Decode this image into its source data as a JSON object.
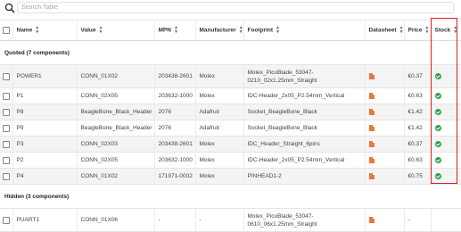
{
  "search": {
    "placeholder": "Search Table"
  },
  "columns": [
    "Name",
    "Value",
    "MPN",
    "Manufacturer",
    "Footprint",
    "Datasheet",
    "Price",
    "Stock"
  ],
  "groups": [
    {
      "label": "Quoted (7 components)",
      "rows": [
        {
          "name": "POWER1",
          "value": "CONN_01X02",
          "mpn": "203438-2601",
          "manufacturer": "Molex",
          "footprint": "Molex_PicoBlade_53047-0210_02x1.25mm_Straight",
          "price": "€0.37",
          "stock": "in-stock"
        },
        {
          "name": "P1",
          "value": "CONN_02X05",
          "mpn": "203632-1000",
          "manufacturer": "Molex",
          "footprint": "IDC-Header_2x05_P2.54mm_Vertical",
          "price": "€0.63",
          "stock": "in-stock"
        },
        {
          "name": "P8",
          "value": "BeagleBone_Black_Header",
          "mpn": "2076",
          "manufacturer": "Adafruit",
          "footprint": "Socket_BeagleBone_Black",
          "price": "€1.42",
          "stock": "in-stock"
        },
        {
          "name": "P9",
          "value": "BeagleBone_Black_Header",
          "mpn": "2076",
          "manufacturer": "Adafruit",
          "footprint": "Socket_BeagleBone_Black",
          "price": "€1.42",
          "stock": "in-stock"
        },
        {
          "name": "P3",
          "value": "CONN_02X03",
          "mpn": "203438-2601",
          "manufacturer": "Molex",
          "footprint": "IDC_Header_Straight_6pins",
          "price": "€0.37",
          "stock": "in-stock"
        },
        {
          "name": "P2",
          "value": "CONN_02X05",
          "mpn": "203632-1000",
          "manufacturer": "Molex",
          "footprint": "IDC-Header_2x05_P2.54mm_Vertical",
          "price": "€0.63",
          "stock": "in-stock"
        },
        {
          "name": "P4",
          "value": "CONN_01X02",
          "mpn": "171971-0002",
          "manufacturer": "Molex",
          "footprint": "PINHEAD1-2",
          "price": "€0.75",
          "stock": "in-stock"
        }
      ]
    },
    {
      "label": "Hidden (3 components)",
      "rows": [
        {
          "name": "PUART1",
          "value": "CONN_01X06",
          "mpn": "-",
          "manufacturer": "-",
          "footprint": "Molex_PicoBlade_53047-0610_06x1.25mm_Straight",
          "price": "-",
          "stock": "none"
        }
      ]
    }
  ],
  "colors": {
    "highlight": "#e01b1b",
    "in_stock": "#2e9e48",
    "pdf": "#e8793a"
  },
  "icons": {
    "search": "search-icon",
    "sort": "sort-icon",
    "datasheet": "pdf-icon",
    "stock": "check-circle-icon"
  }
}
